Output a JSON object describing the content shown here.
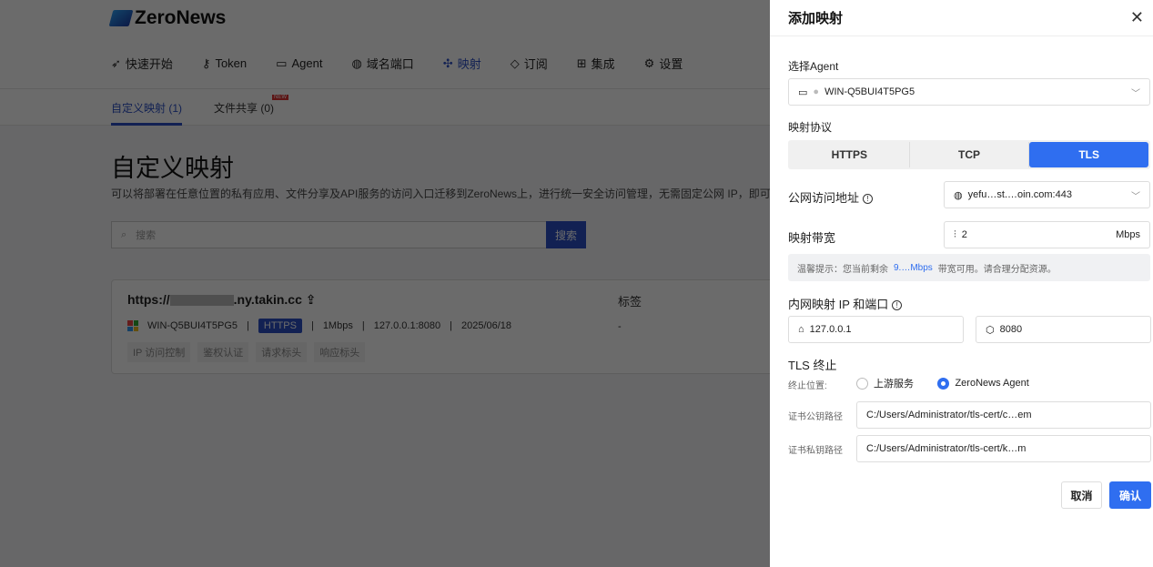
{
  "app": {
    "logo": "ZeroNews"
  },
  "nav": [
    {
      "label": "快速开始",
      "icon": "rocket-icon"
    },
    {
      "label": "Token",
      "icon": "key-icon"
    },
    {
      "label": "Agent",
      "icon": "laptop-icon"
    },
    {
      "label": "域名端口",
      "icon": "globe-icon"
    },
    {
      "label": "映射",
      "icon": "mapping-icon"
    },
    {
      "label": "订阅",
      "icon": "diamond-icon"
    },
    {
      "label": "集成",
      "icon": "apps-icon"
    },
    {
      "label": "设置",
      "icon": "gear-icon"
    }
  ],
  "tabs": {
    "custom": "自定义映射 (1)",
    "share": "文件共享 (0)",
    "new_badge": "NEW"
  },
  "main": {
    "title": "自定义映射",
    "subtitle": "可以将部署在任意位置的私有应用、文件分享及API服务的访问入口迁移到ZeroNews上，进行统一安全访问管理，无需固定公网 IP，即可实",
    "search_placeholder": "搜索",
    "search_button": "搜索"
  },
  "card": {
    "url_prefix": "https://",
    "url_suffix": ".ny.takin.cc",
    "tag_header": "标签",
    "tag_value": "-",
    "agent": "WIN-Q5BUI4T5PG5",
    "protocol": "HTTPS",
    "bandwidth": "1Mbps",
    "target": "127.0.0.1:8080",
    "date": "2025/06/18",
    "actions": [
      "IP 访问控制",
      "鉴权认证",
      "请求标头",
      "响应标头"
    ]
  },
  "drawer": {
    "title": "添加映射",
    "agent_label": "选择Agent",
    "agent_value": "WIN-Q5BUI4T5PG5",
    "protocol_label": "映射协议",
    "protocols": [
      "HTTPS",
      "TCP",
      "TLS"
    ],
    "selected_protocol": "TLS",
    "public_label": "公网访问地址",
    "public_value": "yefu…st.…oin.com:443",
    "bw_label": "映射带宽",
    "bw_value": "2",
    "bw_unit": "Mbps",
    "tip_prefix": "温馨提示：您当前剩余",
    "tip_value": "9.…Mbps",
    "tip_suffix": "带宽可用。请合理分配资源。",
    "inner_label": "内网映射 IP 和端口",
    "ip_value": "127.0.0.1",
    "port_value": "8080",
    "tls_title": "TLS 终止",
    "term_label": "终止位置:",
    "term_options": [
      "上游服务",
      "ZeroNews Agent"
    ],
    "term_selected": "ZeroNews Agent",
    "cert_pub_label": "证书公钥路径",
    "cert_pub_value": "C:/Users/Administrator/tls-cert/c…em",
    "cert_priv_label": "证书私钥路径",
    "cert_priv_value": "C:/Users/Administrator/tls-cert/k…m",
    "cancel": "取消",
    "confirm": "确认"
  }
}
